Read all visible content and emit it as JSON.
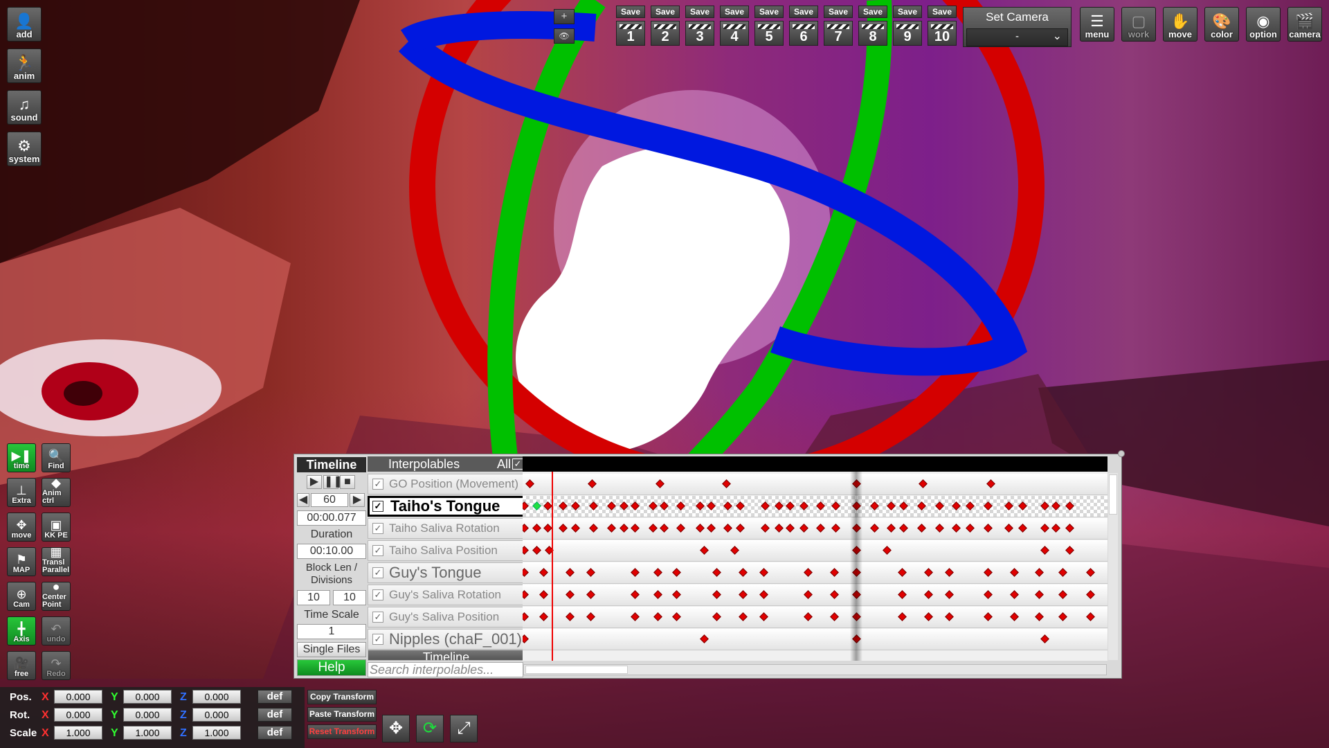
{
  "left_toolbar": [
    {
      "id": "add",
      "label": "add",
      "icon": "person-add-icon"
    },
    {
      "id": "anim",
      "label": "anim",
      "icon": "running-figure-icon"
    },
    {
      "id": "sound",
      "label": "sound",
      "icon": "music-note-icon"
    },
    {
      "id": "system",
      "label": "system",
      "icon": "gears-icon"
    }
  ],
  "left_grid": [
    {
      "id": "time",
      "label": "time",
      "icon": "play-pause-icon",
      "active": true
    },
    {
      "id": "find",
      "label": "Find",
      "icon": "magnifier-icon"
    },
    {
      "id": "extra",
      "label": "Extra",
      "icon": "axes-icon"
    },
    {
      "id": "animctrl",
      "label": "Anim ctrl",
      "icon": "anim-ctrl-icon"
    },
    {
      "id": "move",
      "label": "move",
      "icon": "move-arrows-icon"
    },
    {
      "id": "kkpe",
      "label": "KK PE",
      "icon": "kkpe-icon"
    },
    {
      "id": "map",
      "label": "MAP",
      "icon": "map-flag-icon"
    },
    {
      "id": "transl",
      "label": "Transl Parallel",
      "icon": "translate-parallel-icon"
    },
    {
      "id": "cam",
      "label": "Cam",
      "icon": "camera-target-icon"
    },
    {
      "id": "center",
      "label": "Center Point",
      "icon": "center-point-icon"
    },
    {
      "id": "axis",
      "label": "Axis",
      "icon": "axis-icon",
      "active": true
    },
    {
      "id": "undo",
      "label": "undo",
      "icon": "undo-arrow-icon",
      "dim": true
    },
    {
      "id": "free",
      "label": "free",
      "icon": "camera-free-icon"
    },
    {
      "id": "redo",
      "label": "Redo",
      "icon": "redo-arrow-icon",
      "dim": true
    }
  ],
  "viewport_small": {
    "plus": "+",
    "eye": "👁"
  },
  "save_slots": {
    "save_label": "Save",
    "numbers": [
      "1",
      "2",
      "3",
      "4",
      "5",
      "6",
      "7",
      "8",
      "9",
      "10"
    ]
  },
  "set_camera": {
    "label": "Set Camera",
    "value": "-"
  },
  "right_toolbar": [
    {
      "id": "menu",
      "label": "menu",
      "icon": "menu-list-icon"
    },
    {
      "id": "work",
      "label": "work",
      "icon": "work-window-icon",
      "dim": true
    },
    {
      "id": "move",
      "label": "move",
      "icon": "hand-icon"
    },
    {
      "id": "color",
      "label": "color",
      "icon": "palette-icon"
    },
    {
      "id": "option",
      "label": "option",
      "icon": "eye-icon"
    },
    {
      "id": "camera",
      "label": "camera",
      "icon": "clapper-icon"
    }
  ],
  "timeline": {
    "title": "Timeline",
    "frame_rate": "60",
    "current_time": "00:00.077",
    "duration_label": "Duration",
    "duration": "00:10.00",
    "block_len_label": "Block Len / Divisions",
    "block_len": "10",
    "divisions": "10",
    "time_scale_label": "Time Scale",
    "time_scale": "1",
    "single_files": "Single Files",
    "help": "Help",
    "interpolables_header": "Interpolables",
    "all_label": "All",
    "group_header": "Timeline",
    "search_placeholder": "Search interpolables...",
    "rows": [
      {
        "name": "GO Position (Movement)",
        "style": "normal",
        "keys": [
          10,
          100,
          198,
          294,
          482,
          578,
          676
        ]
      },
      {
        "name": "Taiho's Tongue",
        "style": "sel",
        "keys": [
          2,
          20,
          36,
          58,
          76,
          102,
          128,
          146,
          162,
          188,
          204,
          228,
          256,
          272,
          296,
          314,
          350,
          370,
          386,
          406,
          430,
          452,
          482,
          508,
          532,
          550,
          576,
          602,
          626,
          646,
          672,
          702,
          722,
          754,
          770,
          790
        ]
      },
      {
        "name": "Taiho Saliva Rotation",
        "style": "normal",
        "keys": [
          2,
          20,
          36,
          58,
          76,
          102,
          128,
          146,
          162,
          188,
          204,
          228,
          256,
          272,
          296,
          314,
          350,
          370,
          386,
          406,
          430,
          452,
          482,
          508,
          532,
          550,
          576,
          602,
          626,
          646,
          672,
          702,
          722,
          754,
          770,
          790
        ]
      },
      {
        "name": "Taiho Saliva Position",
        "style": "normal",
        "keys": [
          2,
          20,
          38,
          262,
          306,
          482,
          526,
          754,
          790
        ]
      },
      {
        "name": "Guy's Tongue",
        "style": "big",
        "keys": [
          2,
          30,
          68,
          98,
          162,
          195,
          222,
          280,
          318,
          348,
          412,
          450,
          482,
          548,
          586,
          616,
          672,
          710,
          746,
          780,
          820
        ]
      },
      {
        "name": "Guy's Saliva Rotation",
        "style": "normal",
        "keys": [
          2,
          30,
          68,
          98,
          162,
          195,
          222,
          280,
          318,
          348,
          412,
          450,
          482,
          548,
          586,
          616,
          672,
          710,
          746,
          780,
          820
        ]
      },
      {
        "name": "Guy's Saliva Position",
        "style": "normal",
        "keys": [
          2,
          30,
          68,
          98,
          162,
          195,
          222,
          280,
          318,
          348,
          412,
          450,
          482,
          548,
          586,
          616,
          672,
          710,
          746,
          780,
          820
        ]
      },
      {
        "name": "Nipples (chaF_001)",
        "style": "big",
        "keys": [
          2,
          262,
          482,
          754
        ]
      }
    ]
  },
  "transform": {
    "rows": [
      {
        "label": "Pos.",
        "x": "0.000",
        "y": "0.000",
        "z": "0.000"
      },
      {
        "label": "Rot.",
        "x": "0.000",
        "y": "0.000",
        "z": "0.000"
      },
      {
        "label": "Scale",
        "x": "1.000",
        "y": "1.000",
        "z": "1.000"
      }
    ],
    "axis_x": "X",
    "axis_y": "Y",
    "axis_z": "Z",
    "def_label": "def",
    "copy": "Copy Transform",
    "paste": "Paste Transform",
    "reset": "Reset Transform"
  },
  "colors": {
    "accent_green": "#1ec234",
    "key_red": "#e00000",
    "gizmo_red": "#d40000",
    "gizmo_green": "#00c000",
    "gizmo_blue": "#0018e0"
  }
}
